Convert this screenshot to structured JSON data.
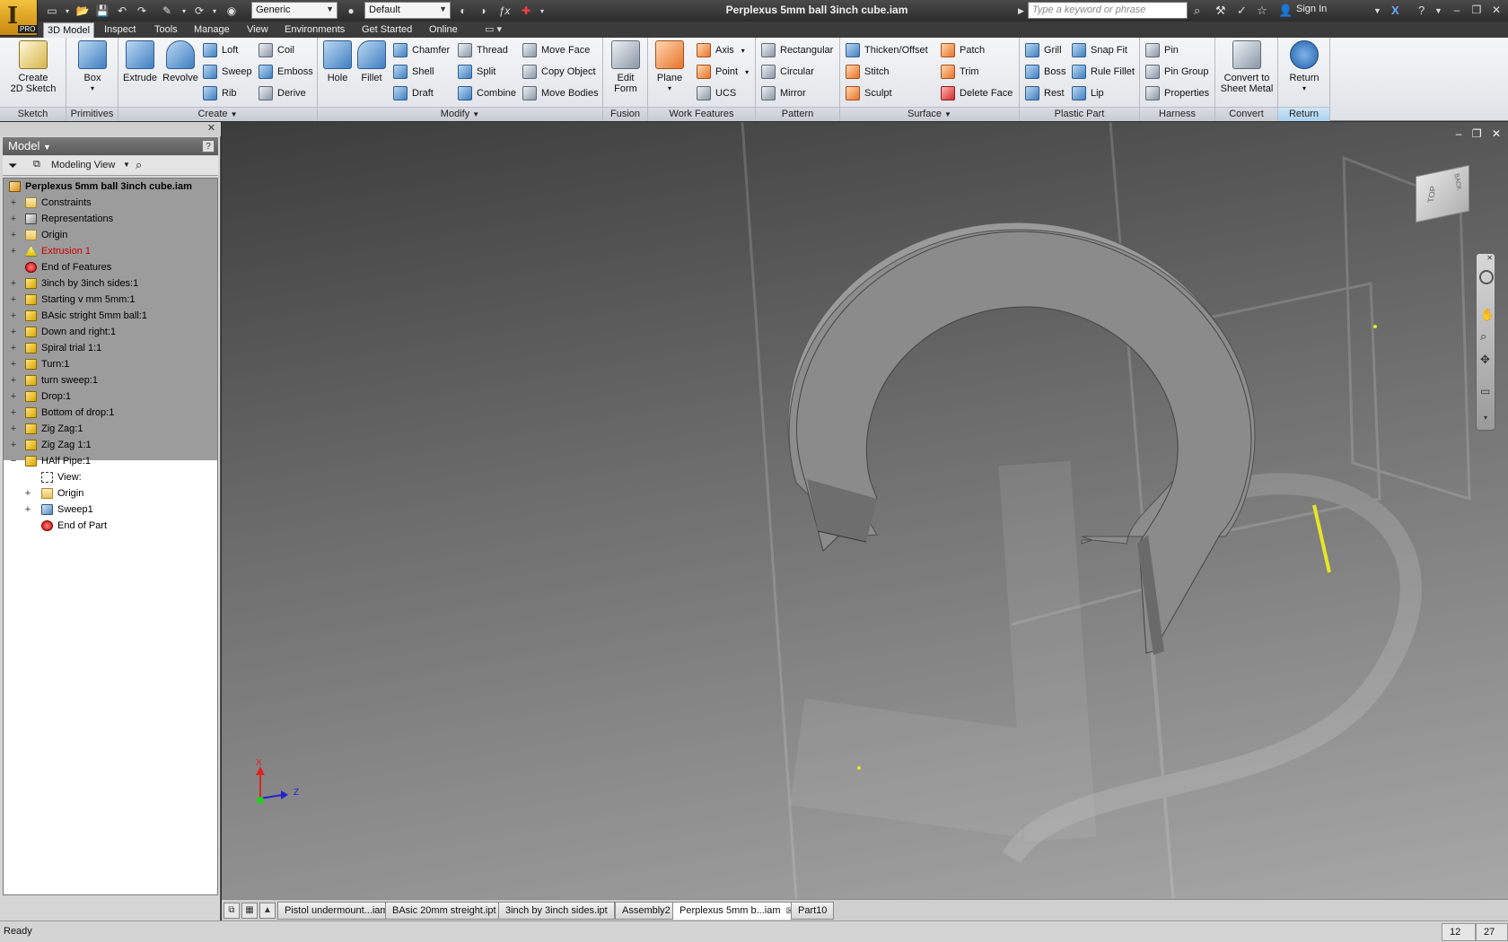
{
  "title_bar": {
    "title": "Perplexus 5mm ball 3inch cube.iam",
    "material": "Generic",
    "appearance": "Default",
    "search_placeholder": "Type a keyword or phrase",
    "sign_in": "Sign In",
    "app_badge": "PRO"
  },
  "tabs": [
    "3D Model",
    "Inspect",
    "Tools",
    "Manage",
    "View",
    "Environments",
    "Get Started",
    "Online"
  ],
  "ribbon": {
    "sketch": {
      "title": "Sketch",
      "create_line1": "Create",
      "create_line2": "2D Sketch"
    },
    "primitives": {
      "title": "Primitives",
      "box": "Box"
    },
    "create": {
      "title": "Create",
      "extrude": "Extrude",
      "revolve": "Revolve",
      "loft": "Loft",
      "sweep": "Sweep",
      "rib": "Rib",
      "coil": "Coil",
      "emboss": "Emboss",
      "derive": "Derive"
    },
    "modify": {
      "title": "Modify",
      "hole": "Hole",
      "fillet": "Fillet",
      "chamfer": "Chamfer",
      "shell": "Shell",
      "draft": "Draft",
      "thread": "Thread",
      "split": "Split",
      "combine": "Combine",
      "move_face": "Move Face",
      "copy_object": "Copy Object",
      "move_bodies": "Move Bodies"
    },
    "fusion": {
      "title": "Fusion",
      "edit_line1": "Edit",
      "edit_line2": "Form"
    },
    "work_features": {
      "title": "Work Features",
      "plane": "Plane",
      "axis": "Axis",
      "point": "Point",
      "ucs": "UCS"
    },
    "pattern": {
      "title": "Pattern",
      "rectangular": "Rectangular",
      "circular": "Circular",
      "mirror": "Mirror"
    },
    "surface": {
      "title": "Surface",
      "thicken": "Thicken/Offset",
      "stitch": "Stitch",
      "sculpt": "Sculpt",
      "patch": "Patch",
      "trim": "Trim",
      "delete_face": "Delete Face"
    },
    "plastic_part": {
      "title": "Plastic Part",
      "grill": "Grill",
      "boss": "Boss",
      "rest": "Rest",
      "snap_fit": "Snap Fit",
      "rule_fillet": "Rule Fillet",
      "lip": "Lip"
    },
    "harness": {
      "title": "Harness",
      "pin": "Pin",
      "pin_group": "Pin Group",
      "properties": "Properties"
    },
    "convert": {
      "title": "Convert",
      "line1": "Convert to",
      "line2": "Sheet Metal"
    },
    "return": {
      "title": "Return",
      "label": "Return"
    }
  },
  "browser": {
    "header": "Model",
    "view_mode": "Modeling View",
    "tree": [
      {
        "label": "Perplexus 5mm ball 3inch cube.iam",
        "indent": 0,
        "icon": "assembly",
        "expander": "",
        "bold": true,
        "color": "#000000"
      },
      {
        "label": "Constraints",
        "indent": 1,
        "icon": "folder",
        "expander": "+",
        "bold": false,
        "color": "#000000"
      },
      {
        "label": "Representations",
        "indent": 1,
        "icon": "representations",
        "expander": "+",
        "bold": false,
        "color": "#000000"
      },
      {
        "label": "Origin",
        "indent": 1,
        "icon": "folder",
        "expander": "+",
        "bold": false,
        "color": "#000000"
      },
      {
        "label": "Extrusion 1",
        "indent": 1,
        "icon": "warning",
        "expander": "+",
        "bold": false,
        "color": "#cc0000"
      },
      {
        "label": "End of Features",
        "indent": 1,
        "icon": "end",
        "expander": "",
        "bold": false,
        "color": "#000000"
      },
      {
        "label": "3inch by 3inch sides:1",
        "indent": 1,
        "icon": "part",
        "expander": "+",
        "bold": false,
        "color": "#000000"
      },
      {
        "label": "Starting v mm 5mm:1",
        "indent": 1,
        "icon": "part",
        "expander": "+",
        "bold": false,
        "color": "#000000"
      },
      {
        "label": "BAsic stright 5mm ball:1",
        "indent": 1,
        "icon": "part",
        "expander": "+",
        "bold": false,
        "color": "#000000"
      },
      {
        "label": "Down and right:1",
        "indent": 1,
        "icon": "part",
        "expander": "+",
        "bold": false,
        "color": "#000000"
      },
      {
        "label": "Spiral trial 1:1",
        "indent": 1,
        "icon": "part",
        "expander": "+",
        "bold": false,
        "color": "#000000"
      },
      {
        "label": "Turn:1",
        "indent": 1,
        "icon": "part",
        "expander": "+",
        "bold": false,
        "color": "#000000"
      },
      {
        "label": "turn sweep:1",
        "indent": 1,
        "icon": "part",
        "expander": "+",
        "bold": false,
        "color": "#000000"
      },
      {
        "label": "Drop:1",
        "indent": 1,
        "icon": "part",
        "expander": "+",
        "bold": false,
        "color": "#000000"
      },
      {
        "label": "Bottom of drop:1",
        "indent": 1,
        "icon": "part",
        "expander": "+",
        "bold": false,
        "color": "#000000"
      },
      {
        "label": "Zig Zag:1",
        "indent": 1,
        "icon": "part",
        "expander": "+",
        "bold": false,
        "color": "#000000"
      },
      {
        "label": "Zig Zag 1:1",
        "indent": 1,
        "icon": "part",
        "expander": "+",
        "bold": false,
        "color": "#000000"
      },
      {
        "label": "HAlf Pipe:1",
        "indent": 1,
        "icon": "part",
        "expander": "−",
        "bold": false,
        "color": "#000000"
      },
      {
        "label": "View:",
        "indent": 2,
        "icon": "view",
        "expander": "",
        "bold": false,
        "color": "#000000"
      },
      {
        "label": "Origin",
        "indent": 2,
        "icon": "folder",
        "expander": "+",
        "bold": false,
        "color": "#000000"
      },
      {
        "label": "Sweep1",
        "indent": 2,
        "icon": "sweep",
        "expander": "+",
        "bold": false,
        "color": "#000000"
      },
      {
        "label": "End of Part",
        "indent": 2,
        "icon": "end",
        "expander": "",
        "bold": false,
        "color": "#000000"
      }
    ]
  },
  "viewcube": {
    "face_top": "TOP",
    "face_back": "BACK"
  },
  "triad": {
    "x": "X",
    "z": "Z"
  },
  "doc_tabs": [
    {
      "label": "Pistol undermount...iam",
      "active": false
    },
    {
      "label": "BAsic 20mm streight.ipt",
      "active": false
    },
    {
      "label": "3inch by 3inch sides.ipt",
      "active": false
    },
    {
      "label": "Assembly2",
      "active": false
    },
    {
      "label": "Perplexus 5mm b...iam",
      "active": true
    },
    {
      "label": "Part10",
      "active": false
    }
  ],
  "status": {
    "text": "Ready",
    "num1": "12",
    "num2": "27"
  }
}
